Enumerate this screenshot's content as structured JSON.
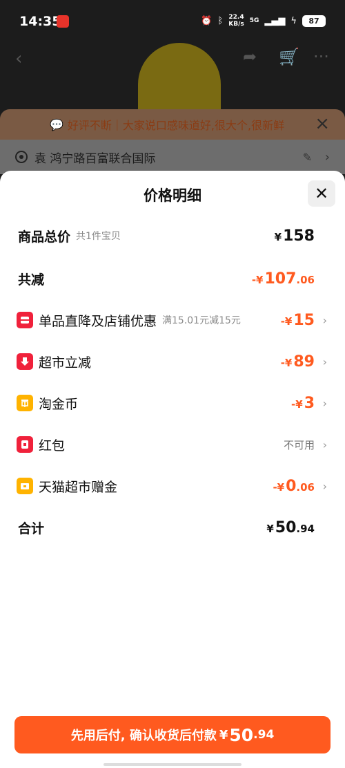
{
  "status": {
    "time": "14:35",
    "net_speed_value": "22.4",
    "net_speed_unit": "KB/s",
    "network": "5G",
    "battery": "87"
  },
  "tip": {
    "text": "好评不断｜大家说口感味道好,很大个,很新鲜"
  },
  "address": {
    "text": "袁 鸿宁路百富联合国际"
  },
  "sheet": {
    "title": "价格明细",
    "total_label": "商品总价",
    "total_sub": "共1件宝贝",
    "total_yen": "¥",
    "total_value": "158",
    "reduce_label": "共减",
    "reduce_prefix": "-¥",
    "reduce_int": "107",
    "reduce_dec": ".06",
    "items": [
      {
        "label": "单品直降及店铺优惠",
        "sub": "满15.01元减15元",
        "prefix": "-¥",
        "int": "15",
        "dec": "",
        "icon": "tag-icon"
      },
      {
        "label": "超市立减",
        "sub": "",
        "prefix": "-¥",
        "int": "89",
        "dec": "",
        "icon": "arrow-down-icon"
      },
      {
        "label": "淘金币",
        "sub": "",
        "prefix": "-¥",
        "int": "3",
        "dec": "",
        "icon": "coin-icon"
      },
      {
        "label": "红包",
        "sub": "",
        "status": "不可用",
        "icon": "red-packet-icon"
      },
      {
        "label": "天猫超市赠金",
        "sub": "",
        "prefix": "-¥",
        "int": "0",
        "dec": ".06",
        "icon": "gift-icon"
      }
    ],
    "sum_label": "合计",
    "sum_yen": "¥",
    "sum_int": "50",
    "sum_dec": ".94"
  },
  "footer": {
    "text": "先用后付, 确认收货后付款",
    "yen": "¥",
    "int": "50",
    "dec": ".94"
  },
  "colors": {
    "accent": "#ff5a1f",
    "icon_red": "#f0213b",
    "icon_yellow": "#ffb300"
  }
}
